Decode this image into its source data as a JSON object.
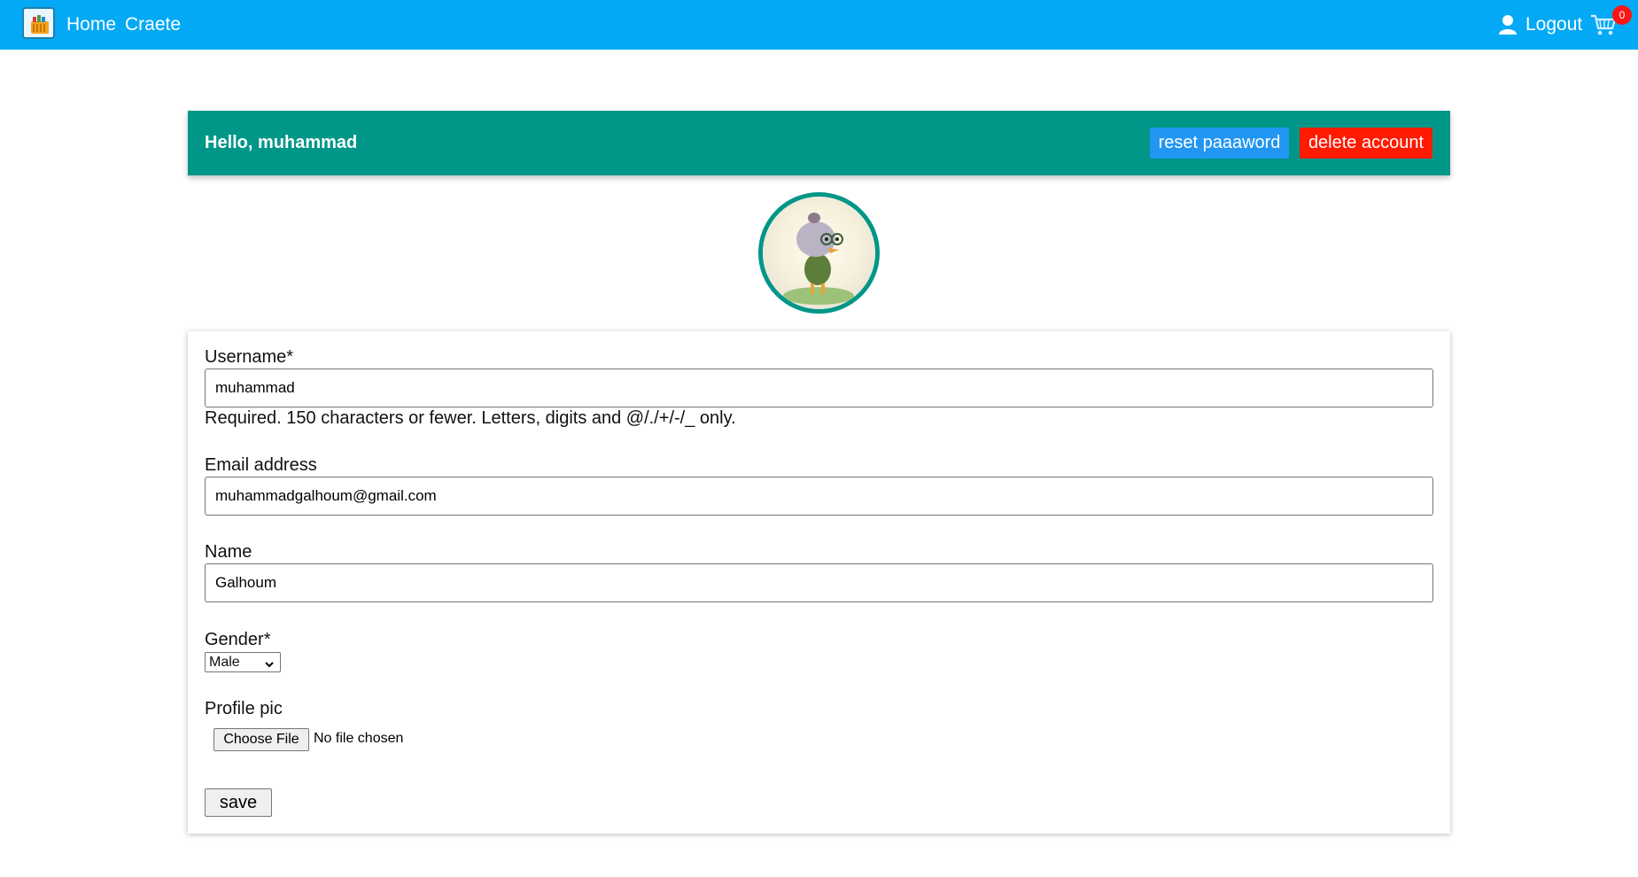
{
  "nav": {
    "logo_icon": "shopping-basket-logo",
    "home": "Home",
    "create": "Craete",
    "logout": "Logout",
    "cart_count": "0",
    "accent": "#03a9f4"
  },
  "greeting": {
    "text": "Hello, muhammad",
    "reset_password": "reset paaaword",
    "delete_account": "delete account",
    "bar_color": "#009688",
    "reset_color": "#2196f3",
    "delete_color": "#ff1a00"
  },
  "avatar": {
    "icon": "cartoon-chicken-avatar"
  },
  "form": {
    "username": {
      "label": "Username*",
      "value": "muhammad",
      "help": "Required. 150 characters or fewer. Letters, digits and @/./+/-/_ only."
    },
    "email": {
      "label": "Email address",
      "value": "muhammadgalhoum@gmail.com"
    },
    "name": {
      "label": "Name",
      "value": "Galhoum"
    },
    "gender": {
      "label": "Gender*",
      "selected": "Male"
    },
    "profile_pic": {
      "label": "Profile pic",
      "button": "Choose File",
      "status": "No file chosen"
    },
    "save": "save"
  }
}
